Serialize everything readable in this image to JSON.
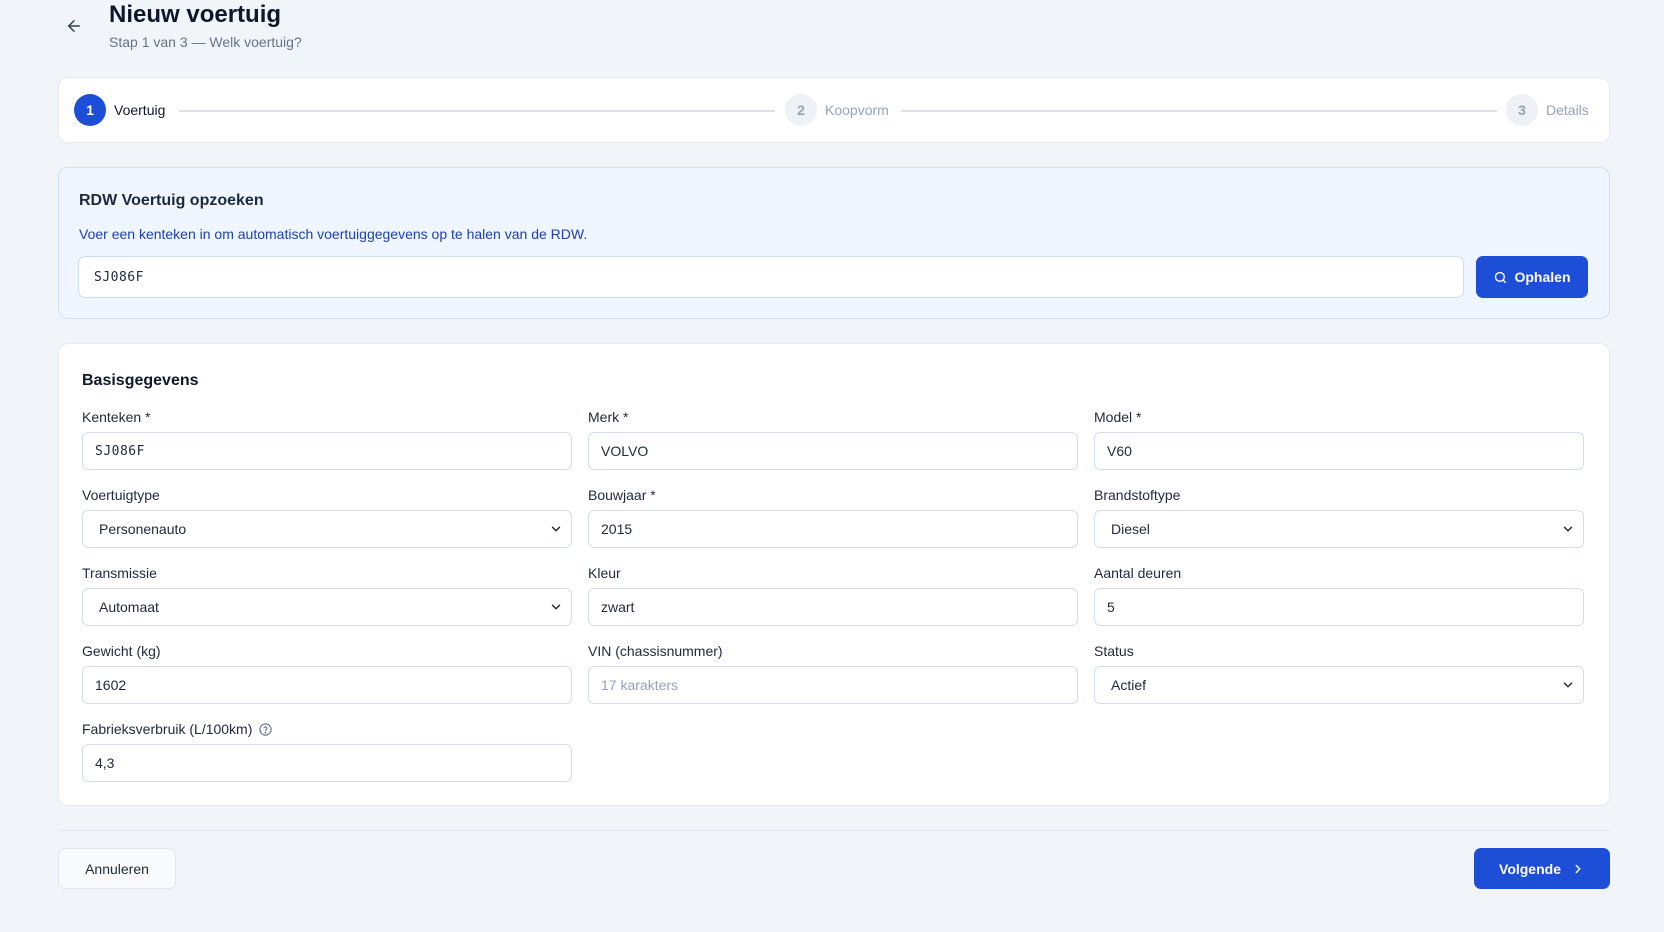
{
  "header": {
    "title": "Nieuw voertuig",
    "subtitle": "Stap 1 van 3 — Welk voertuig?",
    "back_icon": "arrow-left-icon"
  },
  "stepper": {
    "steps": [
      {
        "number": "1",
        "label": "Voertuig",
        "state": "active"
      },
      {
        "number": "2",
        "label": "Koopvorm",
        "state": "inactive"
      },
      {
        "number": "3",
        "label": "Details",
        "state": "inactive"
      }
    ]
  },
  "rdw": {
    "title": "RDW Voertuig opzoeken",
    "description": "Voer een kenteken in om automatisch voertuiggegevens op te halen van de RDW.",
    "plate_value": "SJ086F",
    "fetch_label": "Ophalen",
    "fetch_icon": "search-icon"
  },
  "form": {
    "title": "Basisgegevens",
    "fields": {
      "kenteken": {
        "label": "Kenteken *",
        "value": "SJ086F"
      },
      "merk": {
        "label": "Merk *",
        "value": "VOLVO"
      },
      "model": {
        "label": "Model *",
        "value": "V60"
      },
      "voertuigtype": {
        "label": "Voertuigtype",
        "value": "Personenauto"
      },
      "bouwjaar": {
        "label": "Bouwjaar *",
        "value": "2015"
      },
      "brandstoftype": {
        "label": "Brandstoftype",
        "value": "Diesel"
      },
      "transmissie": {
        "label": "Transmissie",
        "value": "Automaat"
      },
      "kleur": {
        "label": "Kleur",
        "value": "zwart"
      },
      "deuren": {
        "label": "Aantal deuren",
        "value": "5"
      },
      "gewicht": {
        "label": "Gewicht (kg)",
        "value": "1602"
      },
      "vin": {
        "label": "VIN (chassisnummer)",
        "placeholder": "17 karakters"
      },
      "status": {
        "label": "Status",
        "value": "Actief"
      },
      "verbruik": {
        "label": "Fabrieksverbruik (L/100km)",
        "value": "4,3",
        "help_icon": "help-circle-icon"
      }
    }
  },
  "footer": {
    "cancel_label": "Annuleren",
    "next_label": "Volgende",
    "next_icon": "chevron-right-icon"
  },
  "colors": {
    "primary": "#1d4ed8",
    "background": "#f1f4f9",
    "rdw_background": "#eff6ff"
  }
}
